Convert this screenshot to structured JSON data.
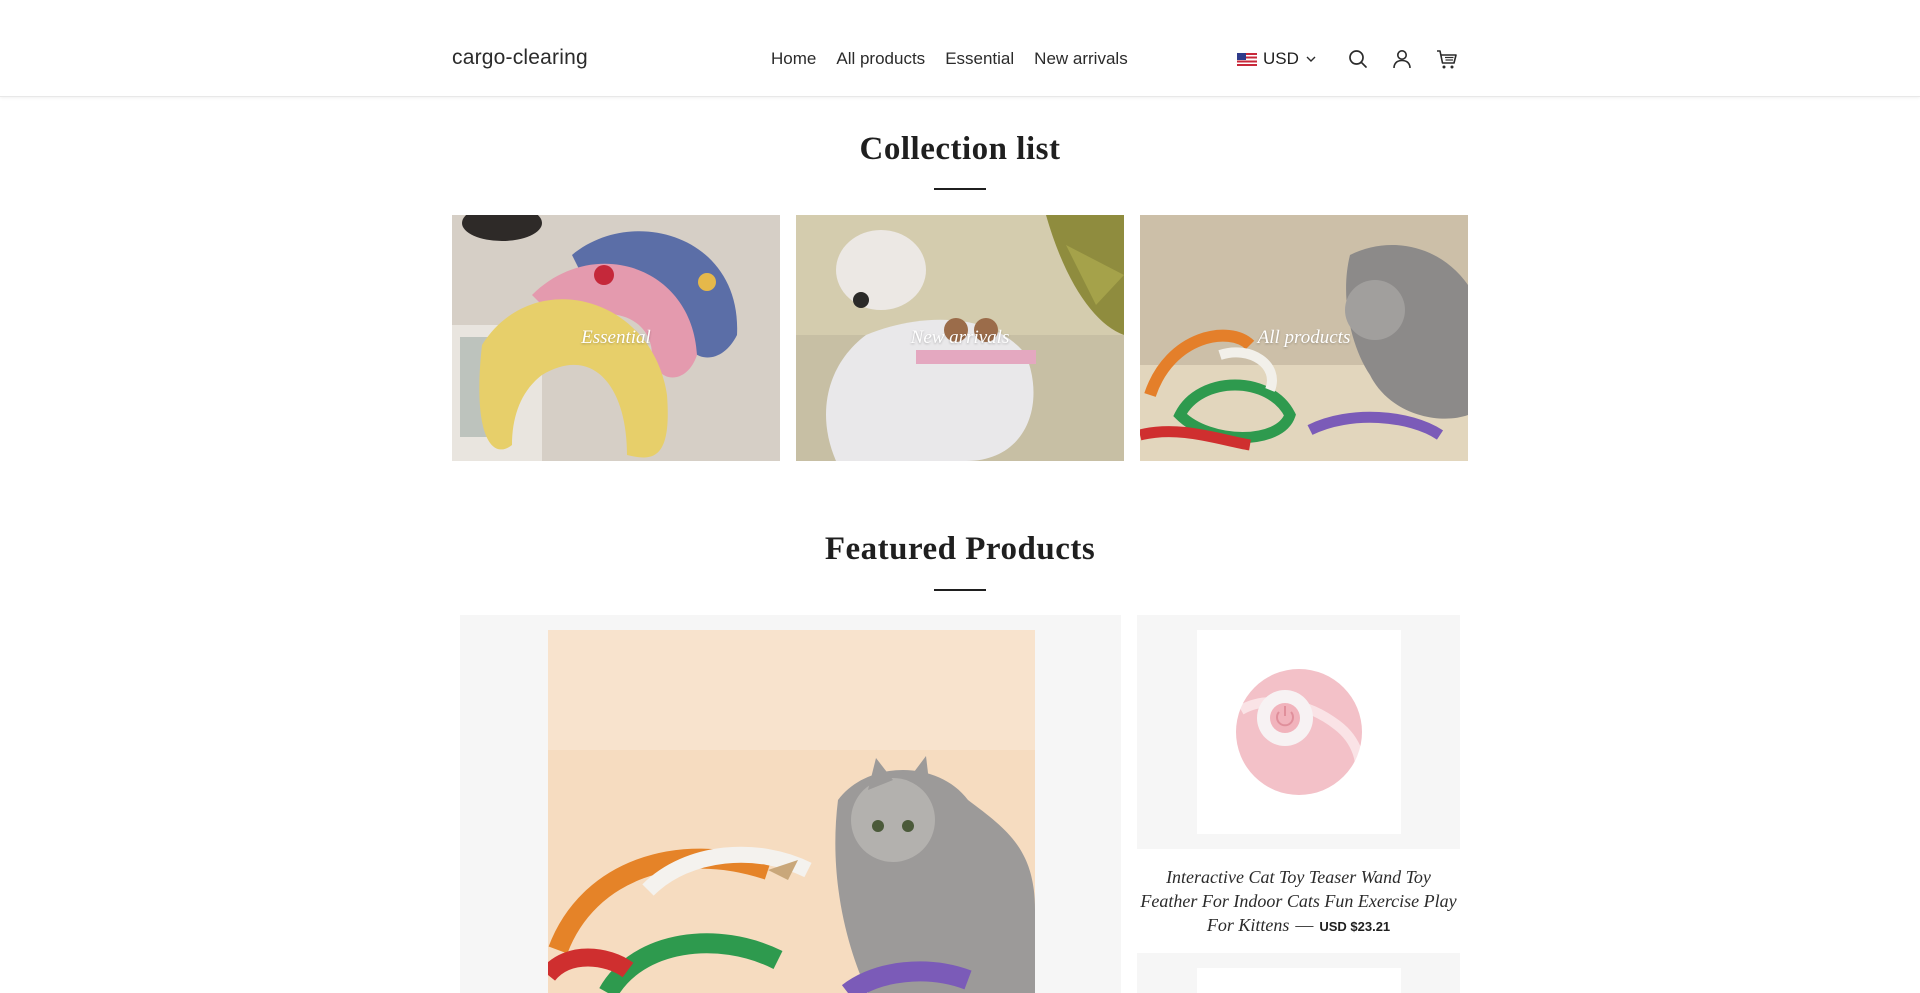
{
  "header": {
    "logo": "cargo-clearing",
    "nav": [
      {
        "label": "Home"
      },
      {
        "label": "All products"
      },
      {
        "label": "Essential"
      },
      {
        "label": "New arrivals"
      }
    ],
    "currency": "USD",
    "icons": [
      "search-icon",
      "account-icon",
      "cart-icon"
    ]
  },
  "collections": {
    "title": "Collection list",
    "items": [
      {
        "label": "Essential"
      },
      {
        "label": "New arrivals"
      },
      {
        "label": "All products"
      }
    ]
  },
  "featured": {
    "title": "Featured Products",
    "products": [
      {
        "title": "Interactive Cat Toy Teaser Wand Toy Feather For Indoor Cats Fun Exercise Play For Kittens",
        "separator": "—",
        "price": "USD $23.21"
      }
    ]
  },
  "colors": {
    "card_background": "#f6f6f6",
    "text": "#1f1f1f",
    "header_border": "#e8e8e8"
  }
}
